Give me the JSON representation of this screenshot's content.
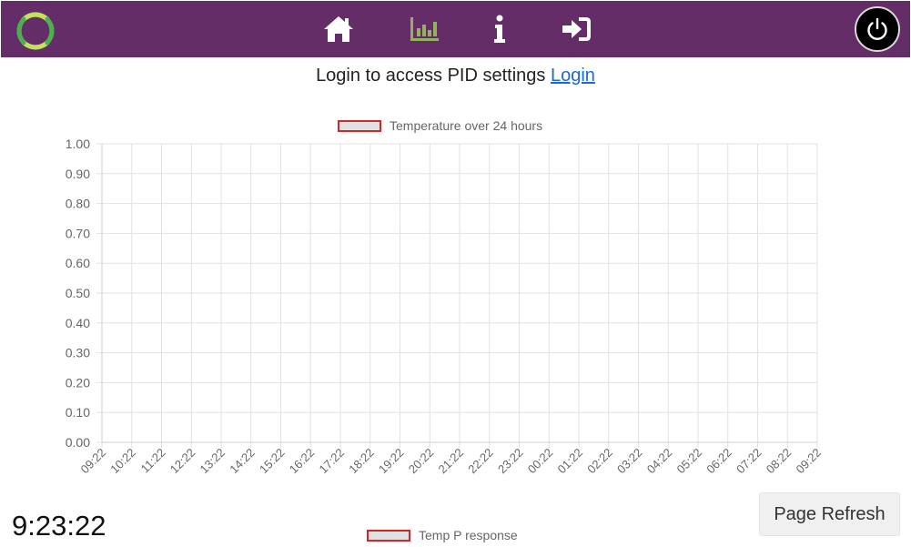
{
  "navbar": {
    "background": "#652d68",
    "logo_icon": "green-ring-logo",
    "items": [
      {
        "icon": "home-icon",
        "active": false
      },
      {
        "icon": "chart-icon",
        "active": true
      },
      {
        "icon": "info-icon",
        "active": false
      },
      {
        "icon": "sign-in-icon",
        "active": false
      }
    ],
    "power_icon": "power-icon"
  },
  "login_prompt": {
    "text": "Login to access PID settings",
    "link_label": "Login"
  },
  "chart_data": [
    {
      "type": "line",
      "series": [
        {
          "name": "Temperature over 24 hours",
          "values": []
        }
      ],
      "categories": [
        "09:22",
        "10:22",
        "11:22",
        "12:22",
        "13:22",
        "14:22",
        "15:22",
        "16:22",
        "17:22",
        "18:22",
        "19:22",
        "20:22",
        "21:22",
        "22:22",
        "23:22",
        "00:22",
        "01:22",
        "02:22",
        "03:22",
        "04:22",
        "05:22",
        "06:22",
        "07:22",
        "08:22",
        "09:22"
      ],
      "y_ticks": [
        "0.00",
        "0.10",
        "0.20",
        "0.30",
        "0.40",
        "0.50",
        "0.60",
        "0.70",
        "0.80",
        "0.90",
        "1.00"
      ],
      "ylim": [
        0,
        1
      ],
      "grid": true,
      "legend_position": "top",
      "legend_colors": {
        "fill": "#e1e1e1",
        "border": "#cc2a2a"
      }
    },
    {
      "type": "line",
      "series": [
        {
          "name": "Temp P response",
          "values": []
        }
      ],
      "legend_position": "top"
    }
  ],
  "clock": "9:23:22",
  "refresh_button": "Page Refresh"
}
